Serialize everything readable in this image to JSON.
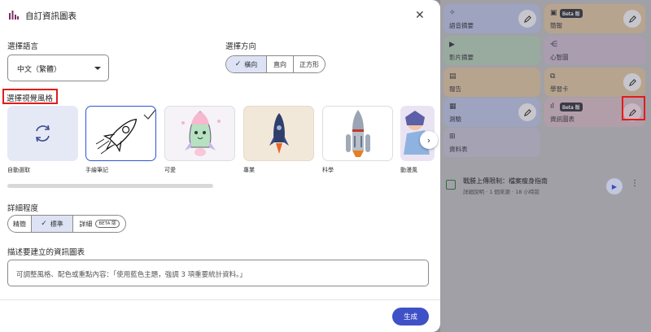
{
  "dialog": {
    "title": "自訂資訊圖表",
    "language_label": "選擇語言",
    "language_value": "中文（繁體）",
    "orientation_label": "選擇方向",
    "orientations": [
      {
        "label": "橫向",
        "selected": true
      },
      {
        "label": "直向",
        "selected": false
      },
      {
        "label": "正方形",
        "selected": false
      }
    ],
    "style_label": "選擇視覺風格",
    "styles": [
      {
        "label": "自動選取",
        "icon": "refresh-icon"
      },
      {
        "label": "手繪筆記",
        "selected": true,
        "icon": "sketch-rocket"
      },
      {
        "label": "可愛",
        "icon": "cute-rocket"
      },
      {
        "label": "專業",
        "icon": "flat-rocket"
      },
      {
        "label": "科學",
        "icon": "realistic-rocket"
      },
      {
        "label": "動漫風",
        "icon": "anime-art"
      }
    ],
    "detail_label": "詳細程度",
    "details": [
      {
        "label": "精簡",
        "selected": false
      },
      {
        "label": "標準",
        "selected": true
      },
      {
        "label": "詳細",
        "selected": false,
        "badge": "BETA 版"
      }
    ],
    "describe_label": "描述要建立的資訊圖表",
    "describe_placeholder": "可調整風格、配色或重點內容：「使用藍色主題，強調 3 項重要統計資料。」",
    "generate_label": "生成"
  },
  "studio": {
    "cards": [
      {
        "label": "語音摘要",
        "icon": "waveform-icon"
      },
      {
        "label": "簡報",
        "badge": "Beta 版",
        "icon": "slides-icon"
      },
      {
        "label": "影片摘要",
        "icon": "video-icon"
      },
      {
        "label": "心智圖",
        "icon": "mindmap-icon"
      },
      {
        "label": "報告",
        "icon": "report-icon"
      },
      {
        "label": "學習卡",
        "icon": "flashcard-icon"
      },
      {
        "label": "測驗",
        "icon": "quiz-icon"
      },
      {
        "label": "資訊圖表",
        "badge": "Beta 版",
        "icon": "infographic-icon"
      },
      {
        "label": "資料表",
        "icon": "table-icon"
      }
    ],
    "source": {
      "title": "戰勝上傳限制：檔案瘦身指南",
      "subtitle": "詳細說明 · 1 個來源 · 18 小時前"
    }
  },
  "colors": {
    "accent": "#3f51c7",
    "highlight": "#e31b1b",
    "selected_border": "#2d55d6"
  }
}
